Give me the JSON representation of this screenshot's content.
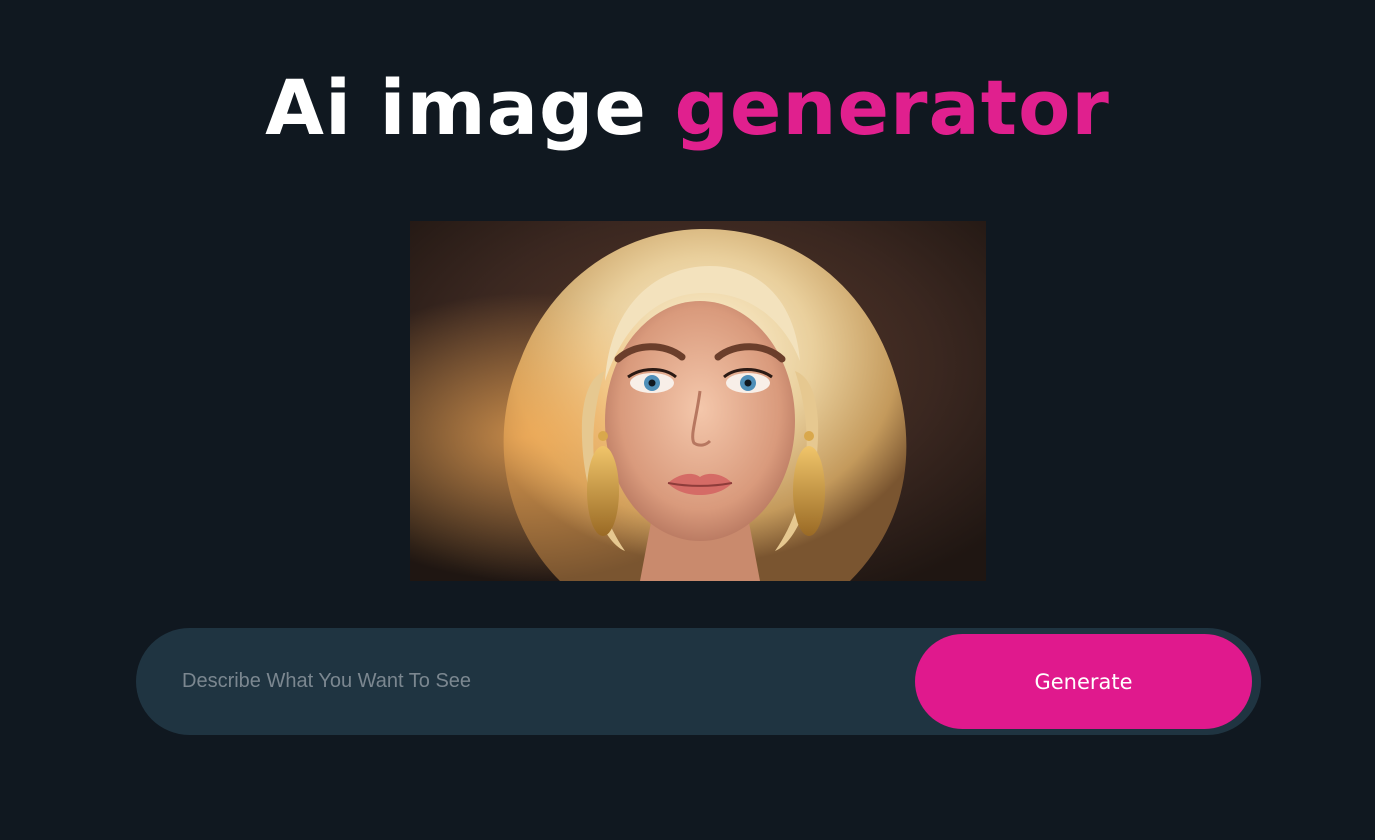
{
  "header": {
    "title_main": "Ai image",
    "title_accent": "generator"
  },
  "preview": {
    "alt": "Generated portrait image"
  },
  "prompt": {
    "placeholder": "Describe What You Want To See",
    "value": "",
    "button_label": "Generate"
  },
  "colors": {
    "background": "#101820",
    "accent": "#e0198d",
    "input_bar": "#1f3441",
    "title_text": "#ffffff"
  }
}
